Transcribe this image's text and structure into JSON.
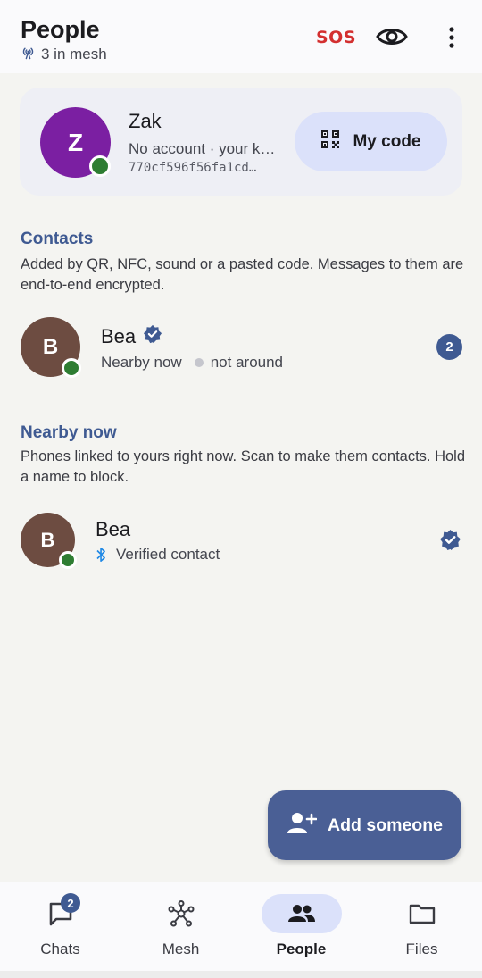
{
  "header": {
    "title": "People",
    "subtitle": "3 in mesh",
    "sos_label": "SOS"
  },
  "me": {
    "initial": "Z",
    "name": "Zak",
    "status": "No account · your key is your identity",
    "key": "770cf596f56fa1cd…",
    "my_code_label": "My code",
    "avatar_color": "#7b1fa2"
  },
  "contacts": {
    "title": "Contacts",
    "description": "Added by QR, NFC, sound or a pasted code. Messages to them are end-to-end encrypted.",
    "items": [
      {
        "initial": "B",
        "name": "Bea",
        "status_primary": "Nearby now",
        "status_secondary": "not around",
        "unread": "2",
        "avatar_color": "#6d4c41"
      }
    ]
  },
  "nearby": {
    "title": "Nearby now",
    "description": "Phones linked to yours right now. Scan to make them contacts. Hold a name to block.",
    "items": [
      {
        "initial": "B",
        "name": "Bea",
        "status": "Verified contact",
        "avatar_color": "#6d4c41"
      }
    ]
  },
  "fab": {
    "label": "Add someone"
  },
  "nav": {
    "items": [
      {
        "label": "Chats",
        "badge": "2"
      },
      {
        "label": "Mesh"
      },
      {
        "label": "People"
      },
      {
        "label": "Files"
      }
    ],
    "active": "People"
  },
  "colors": {
    "accent": "#3f5a92",
    "online": "#2e7d32",
    "sos": "#d32f2f",
    "bluetooth": "#1e88e5"
  }
}
